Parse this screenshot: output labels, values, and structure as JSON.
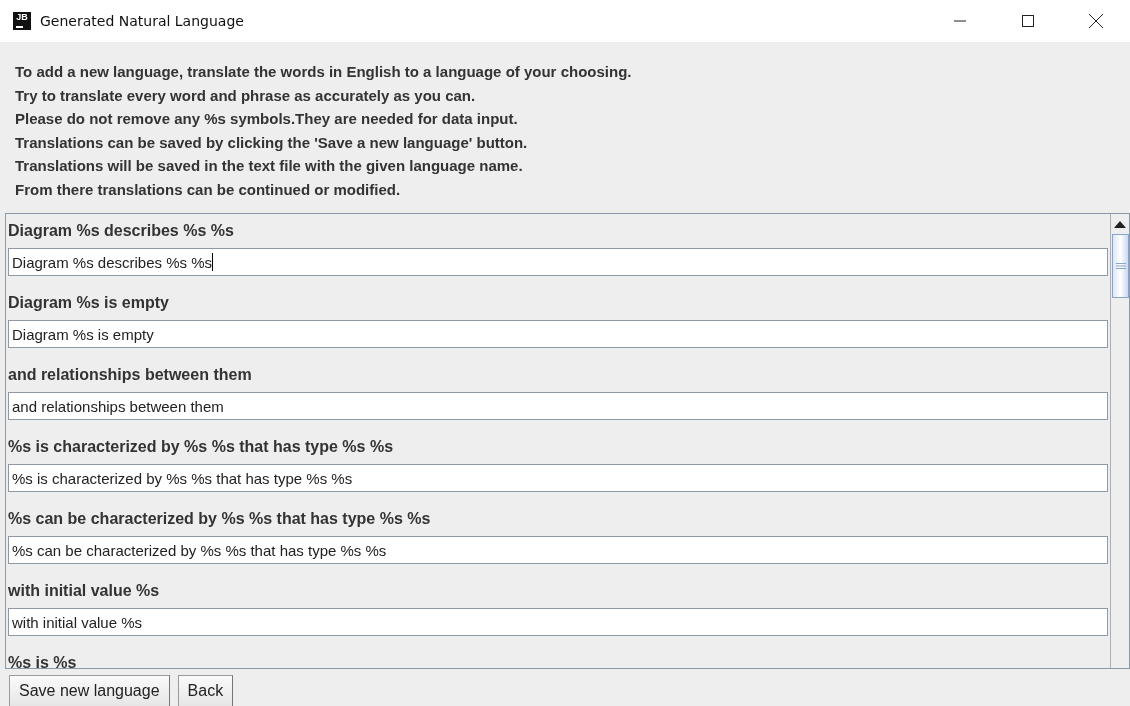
{
  "window": {
    "title": "Generated Natural Language",
    "app_icon": "JB"
  },
  "instructions": [
    "To add a new language, translate the words in English to a language of your choosing.",
    "Try to translate every word and phrase as accurately as you can.",
    "Please do not remove any %s symbols.They are needed for data input.",
    "Translations can be saved by clicking the 'Save a new language' button.",
    "Translations will be saved in the text file with the given language name.",
    "From there translations can be continued or modified."
  ],
  "entries": [
    {
      "label": "Diagram %s describes %s %s",
      "value": "Diagram %s describes %s %s",
      "focused": true
    },
    {
      "label": "Diagram %s is empty",
      "value": "Diagram %s is empty",
      "focused": false
    },
    {
      "label": "and relationships between them",
      "value": "and relationships between them",
      "focused": false
    },
    {
      "label": "%s is characterized by %s %s that has type %s %s",
      "value": "%s is characterized by %s %s that has type %s %s",
      "focused": false
    },
    {
      "label": "%s can be characterized by %s %s that has type %s %s",
      "value": "%s can be characterized by %s %s that has type %s %s",
      "focused": false
    },
    {
      "label": "with initial value %s",
      "value": "with initial value %s",
      "focused": false
    },
    {
      "label": "%s is %s"
    }
  ],
  "buttons": [
    "Save new language",
    "Back"
  ]
}
